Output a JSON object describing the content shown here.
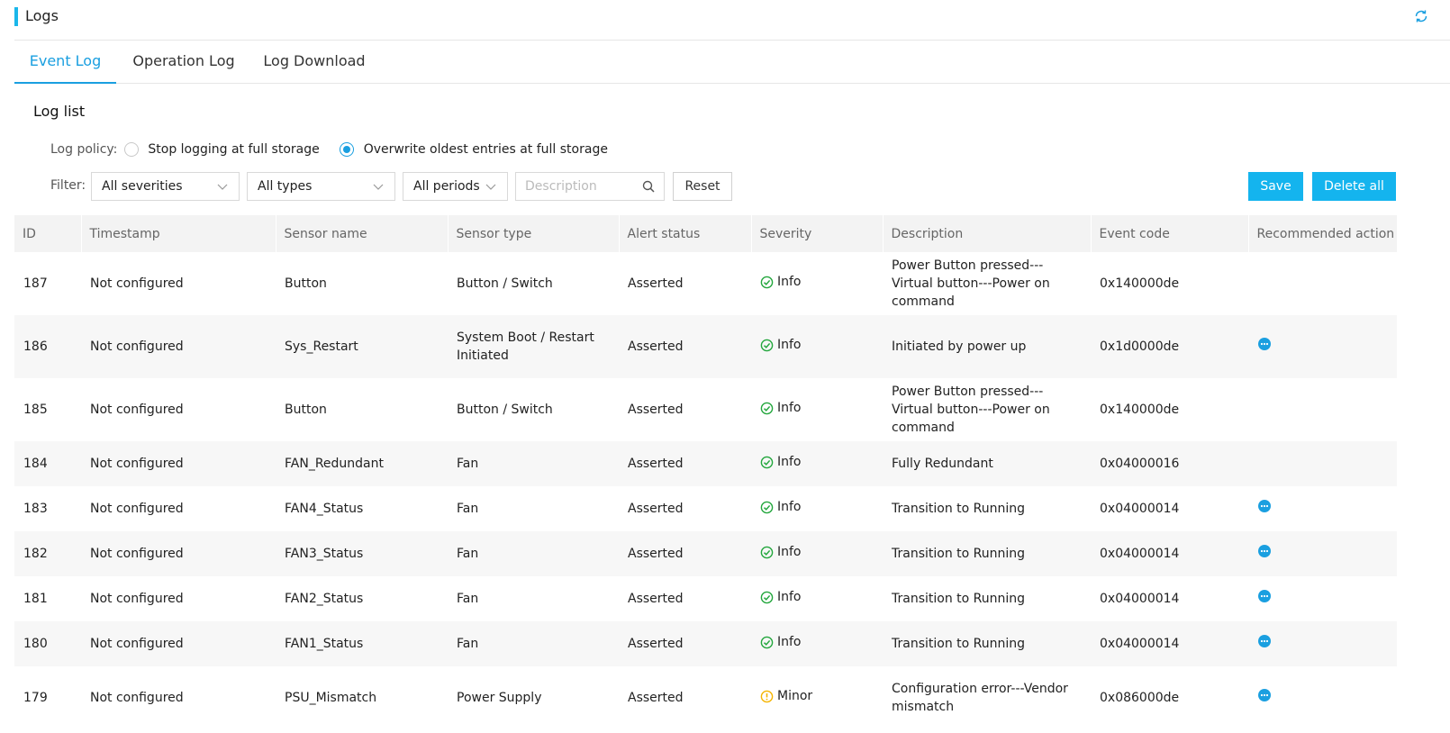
{
  "header": {
    "title": "Logs"
  },
  "tabs": [
    {
      "label": "Event Log",
      "active": true
    },
    {
      "label": "Operation Log",
      "active": false
    },
    {
      "label": "Log Download",
      "active": false
    }
  ],
  "section": {
    "title": "Log list"
  },
  "policy": {
    "label": "Log policy:",
    "options": [
      {
        "label": "Stop logging at full storage",
        "checked": false
      },
      {
        "label": "Overwrite oldest entries at full storage",
        "checked": true
      }
    ]
  },
  "filter": {
    "label": "Filter:",
    "severity": "All severities",
    "type": "All types",
    "period": "All periods",
    "search_placeholder": "Description",
    "reset_label": "Reset",
    "save_label": "Save",
    "delete_all_label": "Delete all"
  },
  "table": {
    "columns": [
      "ID",
      "Timestamp",
      "Sensor name",
      "Sensor type",
      "Alert status",
      "Severity",
      "Description",
      "Event code",
      "Recommended action"
    ],
    "rows": [
      {
        "id": "187",
        "timestamp": "Not configured",
        "sensor_name": "Button",
        "sensor_type": "Button / Switch",
        "alert_status": "Asserted",
        "severity": "Info",
        "description": "Power Button pressed---Virtual button---Power on command",
        "event_code": "0x140000de",
        "action": false
      },
      {
        "id": "186",
        "timestamp": "Not configured",
        "sensor_name": "Sys_Restart",
        "sensor_type": "System Boot / Restart Initiated",
        "alert_status": "Asserted",
        "severity": "Info",
        "description": "Initiated by power up",
        "event_code": "0x1d0000de",
        "action": true
      },
      {
        "id": "185",
        "timestamp": "Not configured",
        "sensor_name": "Button",
        "sensor_type": "Button / Switch",
        "alert_status": "Asserted",
        "severity": "Info",
        "description": "Power Button pressed---Virtual button---Power on command",
        "event_code": "0x140000de",
        "action": false
      },
      {
        "id": "184",
        "timestamp": "Not configured",
        "sensor_name": "FAN_Redundant",
        "sensor_type": "Fan",
        "alert_status": "Asserted",
        "severity": "Info",
        "description": "Fully Redundant",
        "event_code": "0x04000016",
        "action": false
      },
      {
        "id": "183",
        "timestamp": "Not configured",
        "sensor_name": "FAN4_Status",
        "sensor_type": "Fan",
        "alert_status": "Asserted",
        "severity": "Info",
        "description": "Transition to Running",
        "event_code": "0x04000014",
        "action": true
      },
      {
        "id": "182",
        "timestamp": "Not configured",
        "sensor_name": "FAN3_Status",
        "sensor_type": "Fan",
        "alert_status": "Asserted",
        "severity": "Info",
        "description": "Transition to Running",
        "event_code": "0x04000014",
        "action": true
      },
      {
        "id": "181",
        "timestamp": "Not configured",
        "sensor_name": "FAN2_Status",
        "sensor_type": "Fan",
        "alert_status": "Asserted",
        "severity": "Info",
        "description": "Transition to Running",
        "event_code": "0x04000014",
        "action": true
      },
      {
        "id": "180",
        "timestamp": "Not configured",
        "sensor_name": "FAN1_Status",
        "sensor_type": "Fan",
        "alert_status": "Asserted",
        "severity": "Info",
        "description": "Transition to Running",
        "event_code": "0x04000014",
        "action": true
      },
      {
        "id": "179",
        "timestamp": "Not configured",
        "sensor_name": "PSU_Mismatch",
        "sensor_type": "Power Supply",
        "alert_status": "Asserted",
        "severity": "Minor",
        "description": "Configuration error---Vendor mismatch",
        "event_code": "0x086000de",
        "action": true
      }
    ]
  },
  "icons": {
    "refresh": "refresh-icon",
    "search": "search-icon",
    "dropdown": "chevron-down-icon",
    "info": "check-circle-icon",
    "minor": "warning-circle-icon",
    "action": "more-icon"
  },
  "colors": {
    "accent": "#1a9fe0",
    "button": "#14b4ee",
    "info": "#22a63c",
    "minor": "#f5b400"
  }
}
